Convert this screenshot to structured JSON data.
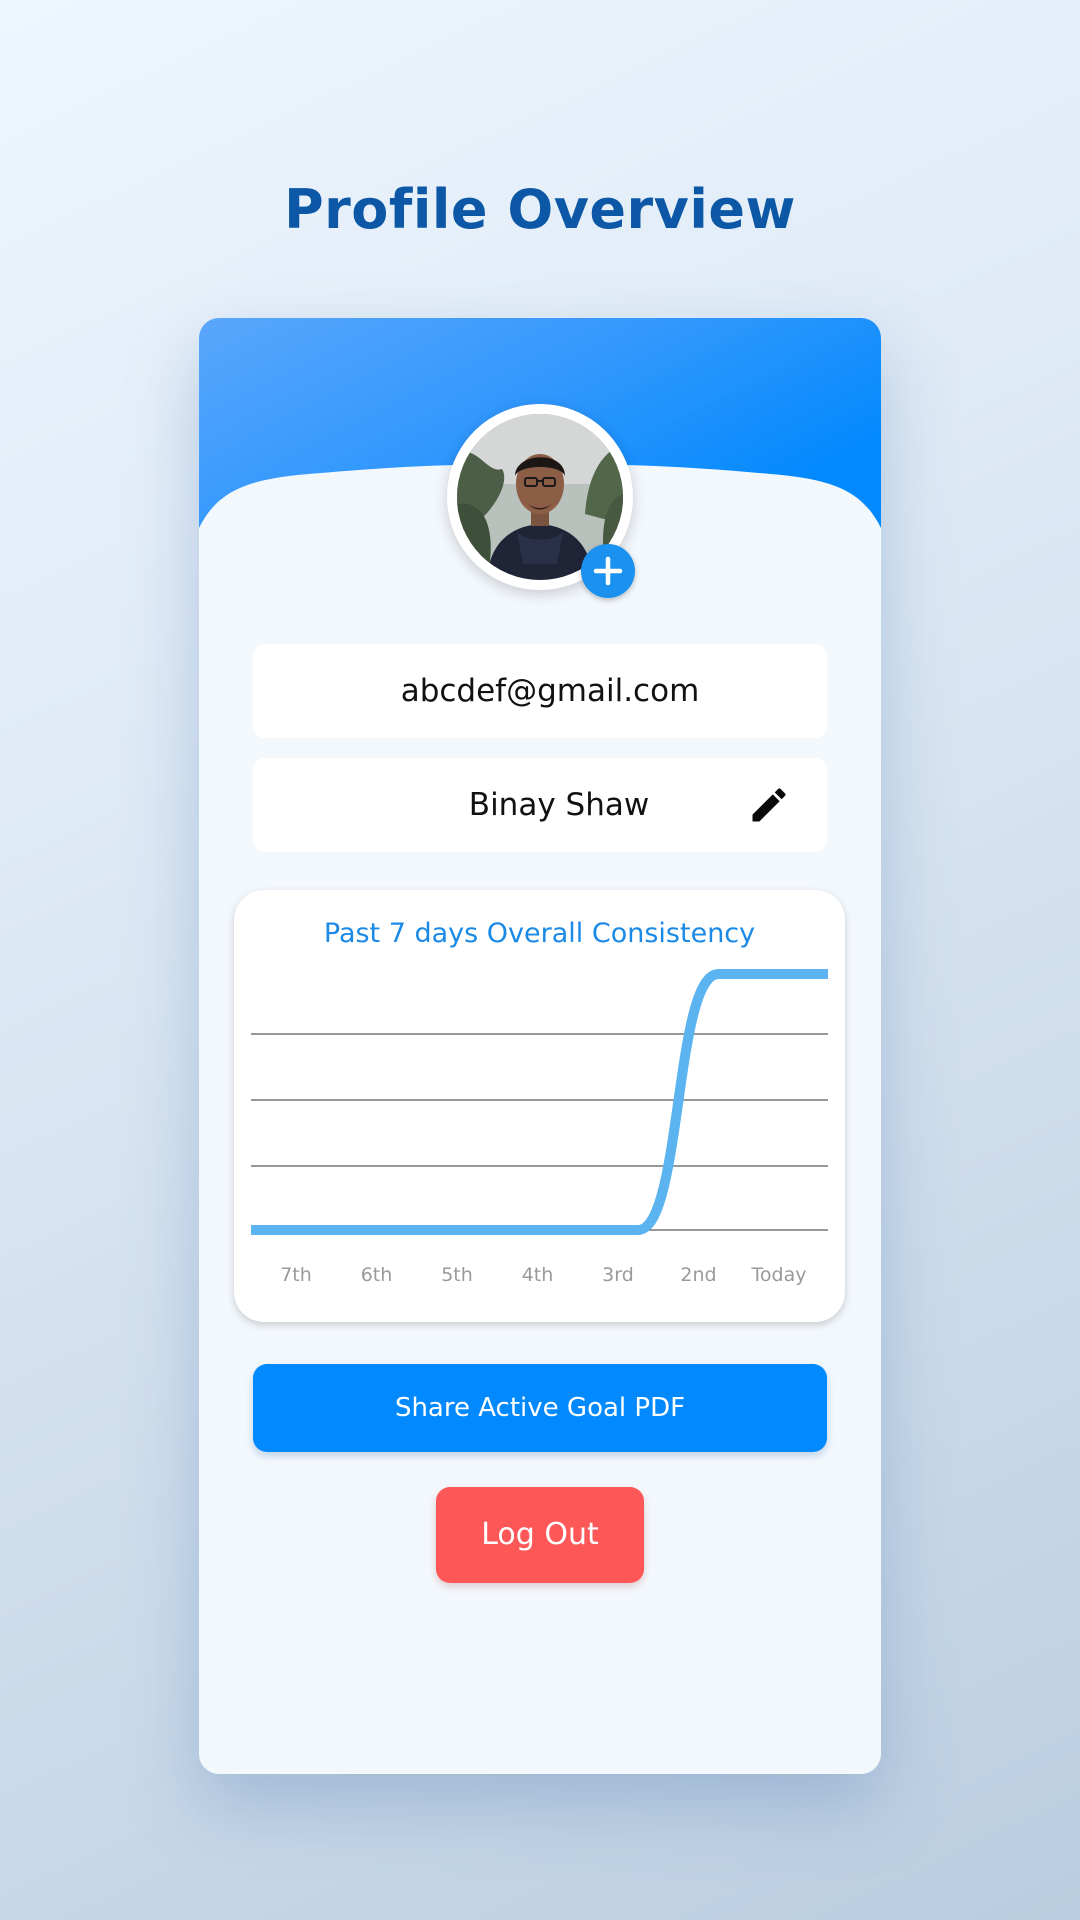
{
  "page": {
    "title": "Profile Overview"
  },
  "profile": {
    "email": "abcdef@gmail.com",
    "name": "Binay Shaw",
    "avatar_icon": "profile-photo",
    "add_photo_icon": "plus-icon",
    "edit_icon": "pencil-icon"
  },
  "chart_data": {
    "type": "line",
    "title": "Past 7 days Overall Consistency",
    "categories": [
      "7th",
      "6th",
      "5th",
      "4th",
      "3rd",
      "2nd",
      "Today"
    ],
    "values": [
      0,
      0,
      0,
      0,
      0,
      1,
      1
    ],
    "ylim": [
      0,
      1
    ],
    "grid": true,
    "smooth": true,
    "color": "#5bb4ef"
  },
  "actions": {
    "share_label": "Share Active Goal PDF",
    "logout_label": "Log Out"
  },
  "colors": {
    "title": "#0c58a6",
    "header_gradient_start": "#5aa6fb",
    "header_gradient_end": "#0289fd",
    "primary_button": "#0289fd",
    "logout_button": "#fe5758",
    "chart_title": "#1b8ae6"
  }
}
